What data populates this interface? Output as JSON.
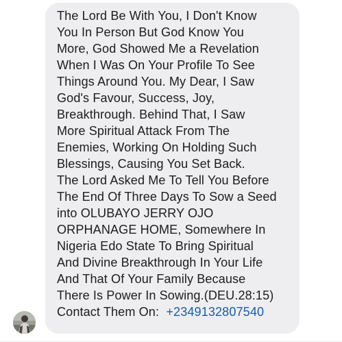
{
  "message": {
    "lines": [
      "The Lord Be With You, I Don't Know",
      "You In Person But God Know You",
      "More, God Showed Me a Revelation",
      "When I Was On Your Profile To See",
      "Things Around You. My Dear, I Saw",
      "God's Favour, Success, Joy,",
      "Breakthrough. Behind That, I Saw",
      "More Spiritual Attack From The",
      "Enemies, Working On Holding Such",
      "Blessings, Causing You Set Back.",
      "The Lord Asked Me To Tell You Before",
      "The End Of Three Days To Sow a Seed",
      "into OLUBAYO JERRY OJO",
      "ORPHANAGE HOME, Somewhere In",
      "Nigeria Edo State To Bring Spiritual",
      "And Divine Breakthrough In Your Life",
      "And That Of Your Family Because",
      "There Is Power In Sowing.(DEU.28:15)"
    ],
    "contact_label": "Contact Them On:",
    "phone_number": "+2349132807540"
  },
  "colors": {
    "bubble_background": "#eeeef0",
    "text": "#1d1d1f",
    "link": "#1b5ea8"
  },
  "sender": {
    "avatar_icon": "user-avatar-photo"
  }
}
